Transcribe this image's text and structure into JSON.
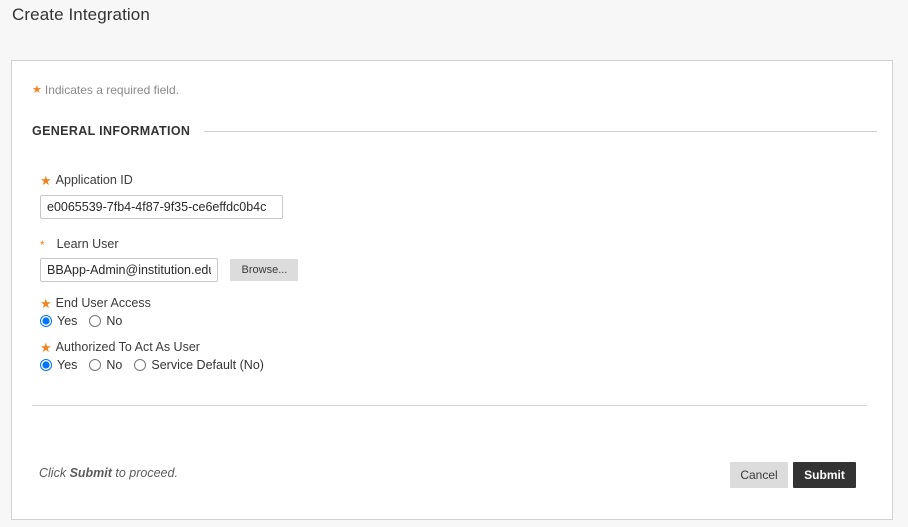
{
  "page": {
    "title": "Create Integration",
    "required_note": "Indicates a required field.",
    "required_star": "★"
  },
  "section": {
    "general_information_label": "GENERAL INFORMATION"
  },
  "fields": {
    "application_id": {
      "label": "Application ID",
      "marker": "★",
      "value": "e0065539-7fb4-4f87-9f35-ce6effdc0b4c",
      "placeholder": ""
    },
    "learn_user": {
      "label": "Learn User",
      "marker": "*",
      "value": "BBApp-Admin@institution.edu",
      "placeholder": "",
      "browse_label": "Browse..."
    },
    "end_user_access": {
      "label": "End User Access",
      "marker": "★",
      "selected": "Yes",
      "options": [
        "Yes",
        "No"
      ],
      "option_yes": "Yes",
      "option_no": "No"
    },
    "authorized_to_act_as_user": {
      "label": "Authorized To Act As User",
      "marker": "★",
      "selected": "Yes",
      "options": [
        "Yes",
        "No",
        "Service Default (No)"
      ],
      "option_yes": "Yes",
      "option_no": "No",
      "option_service_default": "Service Default (No)"
    }
  },
  "footer": {
    "hint_prefix": "Click ",
    "hint_bold": "Submit",
    "hint_suffix": " to proceed.",
    "cancel_label": "Cancel",
    "submit_label": "Submit"
  },
  "colors": {
    "accent": "#f08422",
    "submit_background": "#333333",
    "cancel_background": "#dcdcdc",
    "page_background": "#f7f7f7",
    "panel_background": "#ffffff"
  }
}
